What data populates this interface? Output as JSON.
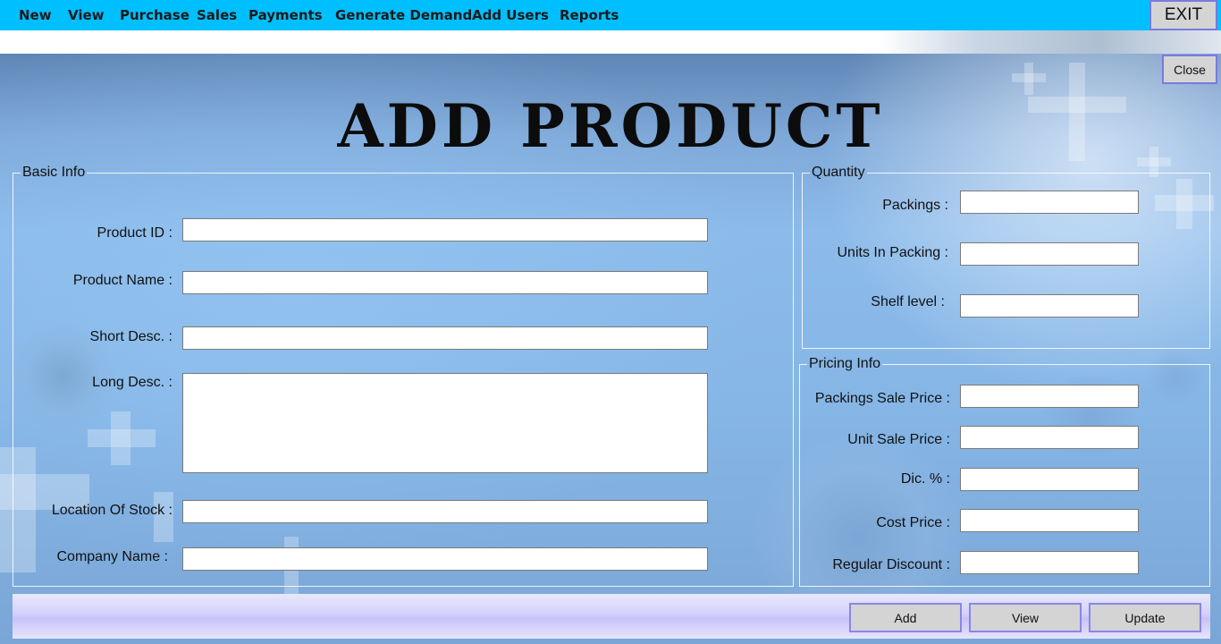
{
  "menu": {
    "items": [
      {
        "label": "New"
      },
      {
        "label": "View"
      },
      {
        "label": "Purchase"
      },
      {
        "label": "Sales"
      },
      {
        "label": "Payments"
      },
      {
        "label": "Generate Demand"
      },
      {
        "label": "Add Users"
      },
      {
        "label": "Reports"
      }
    ],
    "exit_label": "EXIT"
  },
  "form": {
    "close_label": "Close",
    "title": "ADD PRODUCT",
    "basic_info": {
      "legend": "Basic Info",
      "product_id_label": "Product ID :",
      "product_name_label": "Product Name :",
      "short_desc_label": "Short Desc. :",
      "long_desc_label": "Long Desc. :",
      "location_label": "Location Of Stock :",
      "company_label": "Company Name :",
      "values": {
        "product_id": "",
        "product_name": "",
        "short_desc": "",
        "long_desc": "",
        "location": "",
        "company": ""
      }
    },
    "quantity": {
      "legend": "Quantity",
      "packings_label": "Packings :",
      "units_label": "Units In Packing :",
      "shelf_label": "Shelf level :",
      "values": {
        "packings": "",
        "units": "",
        "shelf": ""
      }
    },
    "pricing": {
      "legend": "Pricing Info",
      "packings_sale_label": "Packings Sale Price :",
      "unit_sale_label": "Unit Sale Price :",
      "disc_label": "Dic. % :",
      "cost_label": "Cost Price :",
      "regular_discount_label": "Regular Discount :",
      "values": {
        "packings_sale": "",
        "unit_sale": "",
        "disc": "",
        "cost": "",
        "regular_discount": ""
      }
    },
    "actions": {
      "add_label": "Add",
      "view_label": "View",
      "update_label": "Update"
    }
  },
  "colors": {
    "menubar": "#00bfff",
    "button_border": "#7a7adf",
    "button_face": "#d4d4d4"
  },
  "icons": {
    "background": "medical-cross-decor"
  }
}
